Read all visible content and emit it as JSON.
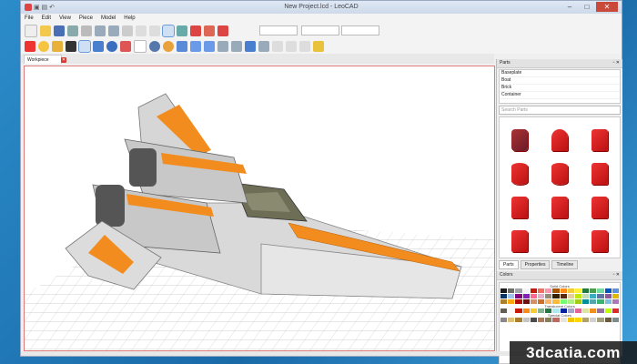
{
  "window": {
    "title": "New Project.lcd - LeoCAD"
  },
  "menu": [
    "File",
    "Edit",
    "View",
    "Piece",
    "Model",
    "Help"
  ],
  "doc_tab": {
    "label": "Workpiece"
  },
  "parts_panel": {
    "title": "Parts",
    "categories": [
      "Baseplate",
      "Boat",
      "Brick",
      "Container"
    ],
    "search_placeholder": "Search Parts",
    "tabs": [
      "Parts",
      "Properties",
      "Timeline"
    ]
  },
  "colors_panel": {
    "title": "Colors",
    "groups": [
      "Solid Colors",
      "Translucent Colors",
      "Special Colors"
    ]
  },
  "watermark": "3dcatia.com",
  "palette": {
    "solid": [
      "#1b1b1b",
      "#6c6e68",
      "#a0a5a9",
      "#f4f4f4",
      "#c91a09",
      "#f2705e",
      "#fc97ac",
      "#a95500",
      "#fe8a18",
      "#f2cd37",
      "#fff03a",
      "#237841",
      "#4b9f4a",
      "#73dca1",
      "#0055bf",
      "#5a93db"
    ],
    "solid2": [
      "#0a3463",
      "#9fc3e9",
      "#81007b",
      "#8320b7",
      "#ff698f",
      "#e4adc8",
      "#958a73",
      "#352100",
      "#582a12",
      "#e4cd9e",
      "#bbe90b",
      "#c2dab8",
      "#36aebf",
      "#6074a1",
      "#8e5597",
      "#dfb900"
    ],
    "solid3": [
      "#aa7f2e",
      "#ffa70b",
      "#b31004",
      "#720e0f",
      "#d09168",
      "#cc702a",
      "#fcb76d",
      "#f8bb3d",
      "#78fc78",
      "#aeef86",
      "#a5ca18",
      "#008f9b",
      "#55a5af",
      "#3cb371",
      "#7dbfdd",
      "#ac78ba"
    ],
    "trans": [
      "#635f52",
      "#fcfcfc",
      "#c91a09",
      "#fe8a18",
      "#f5cd2f",
      "#84b68d",
      "#237841",
      "#aee9ef",
      "#0020a0",
      "#a5a5cb",
      "#df6695",
      "#d9e4a7",
      "#f08f1c",
      "#96709f",
      "#c0ff00",
      "#e02a29"
    ],
    "special": [
      "#898788",
      "#dfc176",
      "#aa7f2e",
      "#c6c6c6",
      "#484d48",
      "#ae7a59",
      "#897e5c",
      "#bb6a5f",
      "#e4e4e4",
      "#f3c305",
      "#ffd700",
      "#b0a06f",
      "#d0d0d0",
      "#a4a07e",
      "#6b5a3e",
      "#7a8c8b"
    ]
  }
}
